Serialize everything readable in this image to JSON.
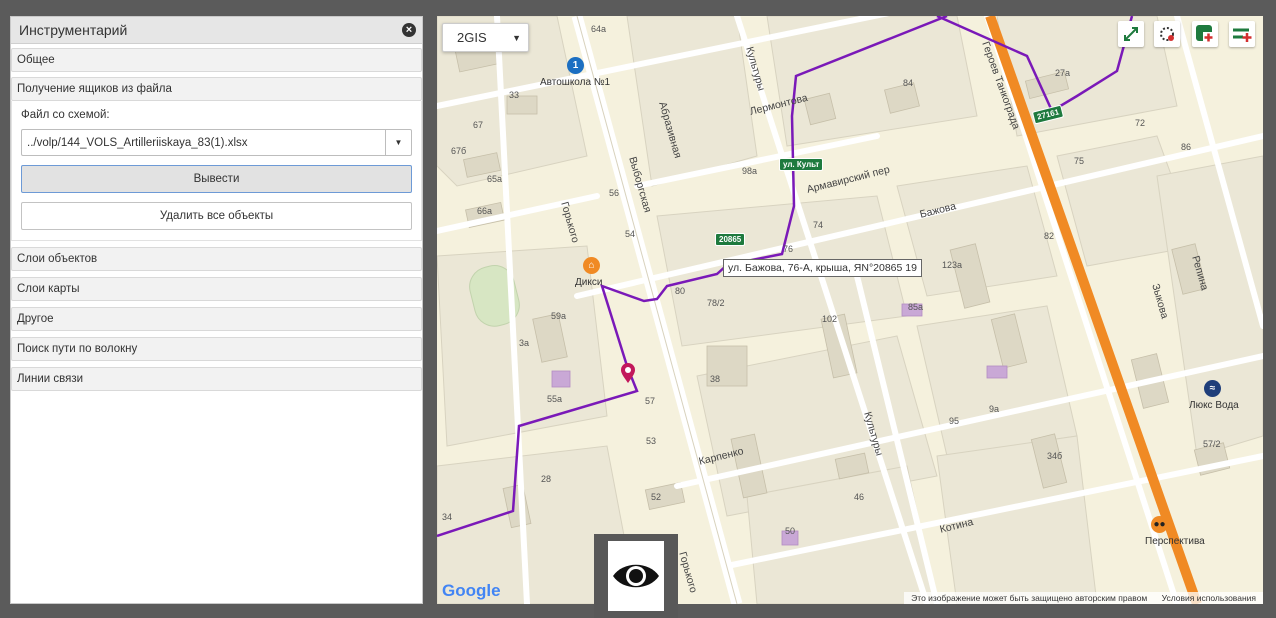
{
  "panel": {
    "title": "Инструментарий",
    "sections": {
      "general": "Общее",
      "load_boxes": "Получение ящиков из файла",
      "object_layers": "Слои объектов",
      "map_layers": "Слои карты",
      "other": "Другое",
      "fiber_path": "Поиск пути по волокну",
      "links": "Линии связи"
    },
    "file_label": "Файл со схемой:",
    "file_value": "../volp/144_VOLS_Artilleriiskaya_83(1).xlsx",
    "output_button": "Вывести",
    "delete_button": "Удалить все объекты"
  },
  "map": {
    "map_type": "2GIS",
    "streets": {
      "gorkogo_top": "Горького",
      "gorkogo_bottom": "Горького",
      "vyborgskaya": "Выборгская",
      "abrazivnaya": "Абразивная",
      "lermontova": "Лермонтова",
      "kultury_top": "Культуры",
      "kultury_mid": "Культуры",
      "armavirsky": "Армавирский пер",
      "bazhova": "Бажова",
      "karpenko": "Карпенко",
      "kotina": "Котина",
      "tankogradtsev": "Героев Танкограда",
      "zykova": "Зыкова",
      "repina": "Репина"
    },
    "pois": {
      "autoschool": "Автошкола №1",
      "diksi": "Дикси",
      "lux_voda": "Люкс Вода",
      "perspektiva": "Перспектива"
    },
    "bus_stops": {
      "kultury": "ул. Культ",
      "stop_20865": "20865",
      "stop_27161": "27161"
    },
    "tooltip": "ул. Бажова, 76-А, крыша, ЯN°20865 19",
    "house_numbers": [
      "64а",
      "33",
      "67",
      "67б",
      "65а",
      "66а",
      "59а",
      "3а",
      "55а",
      "53",
      "28",
      "34",
      "57",
      "56",
      "54",
      "38",
      "52",
      "46",
      "50",
      "95",
      "9а",
      "123а",
      "82",
      "76",
      "74",
      "80",
      "102",
      "85а",
      "27а",
      "72",
      "75",
      "78/2",
      "98а",
      "84",
      "86",
      "34б",
      "57/2"
    ],
    "google": "Google",
    "attribution": "Это изображение может быть защищено авторским правом",
    "terms": "Условия использования"
  },
  "colors": {
    "route": "#7a19b8",
    "main_road": "#f08a24",
    "bus_tag": "#1e7a3e",
    "map_bg": "#f5f1dd",
    "building": "#e6e2d3"
  }
}
